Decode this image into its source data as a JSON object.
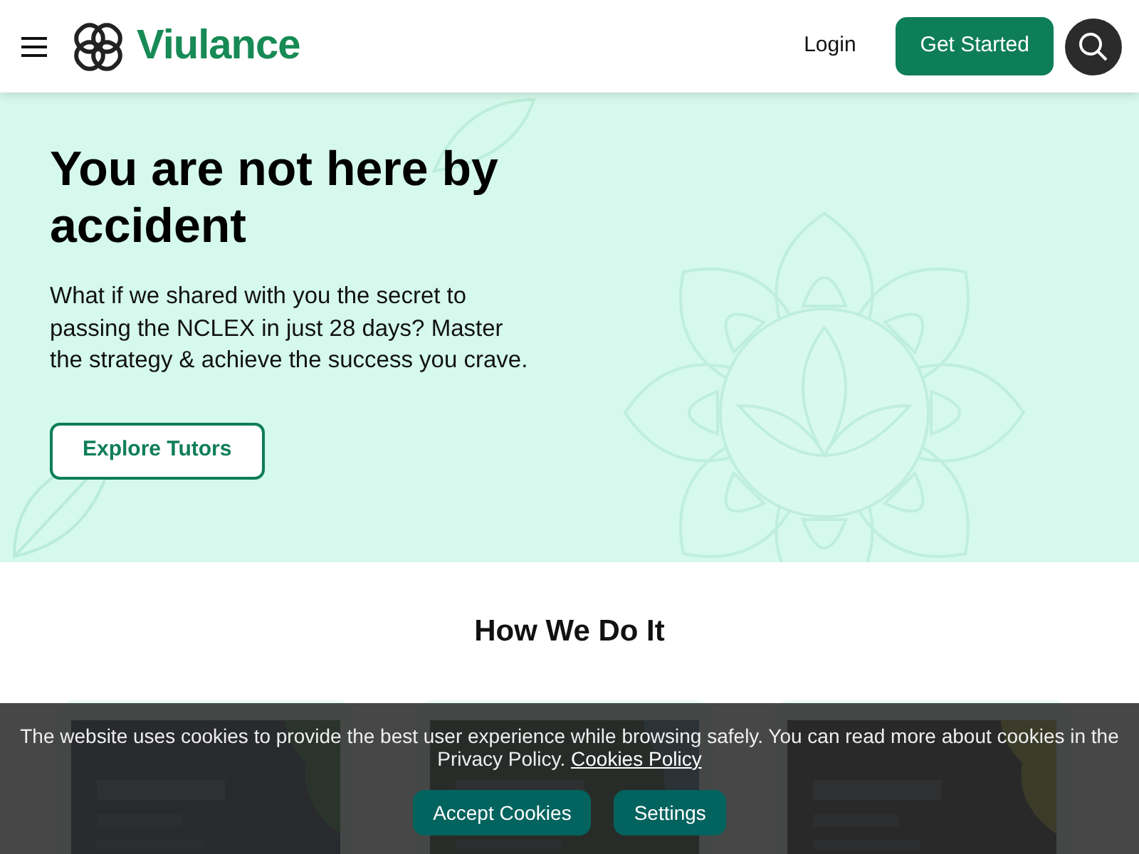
{
  "navbar": {
    "brand": "Viulance",
    "login": "Login",
    "cta": "Get Started"
  },
  "hero": {
    "title": "You are not here by accident",
    "text": "What if we shared with you the secret to passing the NCLEX in just 28 days? Master the strategy & achieve the success you crave.",
    "button": "Explore Tutors"
  },
  "section": {
    "title": "How We Do It"
  },
  "cookie_banner": {
    "text": "The website uses cookies to provide the best user experience while browsing safely. You can read more about cookies in the Privacy Policy.",
    "link": "Cookies Policy",
    "buttons": [
      "Accept Cookies",
      "Settings"
    ]
  }
}
